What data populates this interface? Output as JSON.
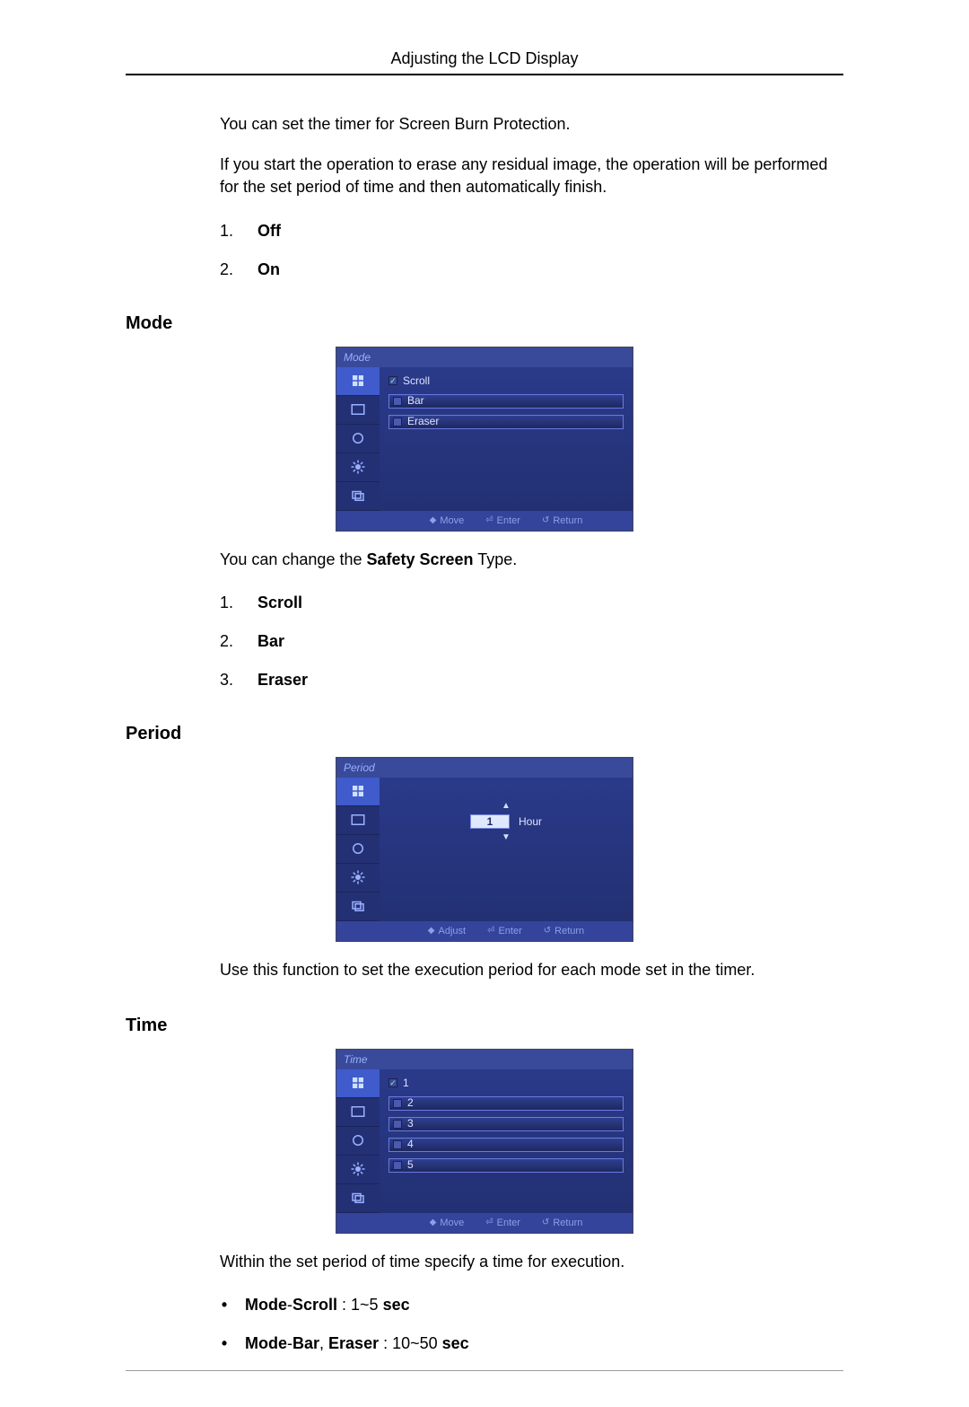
{
  "header": {
    "title": "Adjusting the LCD Display"
  },
  "intro": {
    "p1": "You can set the timer for Screen Burn Protection.",
    "p2": "If you start the operation to erase any residual image, the operation will be performed for the set period of time and then automatically finish."
  },
  "timer_options": {
    "items": [
      {
        "num": "1.",
        "label": "Off"
      },
      {
        "num": "2.",
        "label": "On"
      }
    ]
  },
  "mode_section": {
    "heading": "Mode",
    "caption_prefix": "You can change the ",
    "caption_bold": "Safety Screen",
    "caption_suffix": " Type.",
    "items": [
      {
        "num": "1.",
        "label": "Scroll"
      },
      {
        "num": "2.",
        "label": "Bar"
      },
      {
        "num": "3.",
        "label": "Eraser"
      }
    ],
    "osd": {
      "title": "Mode",
      "rows": [
        {
          "checked": true,
          "label": "Scroll"
        },
        {
          "checked": false,
          "label": "Bar"
        },
        {
          "checked": false,
          "label": "Eraser"
        }
      ],
      "hints": {
        "move": "Move",
        "enter": "Enter",
        "return": "Return"
      }
    }
  },
  "period_section": {
    "heading": "Period",
    "caption": "Use this function to set the execution period for each mode set in the timer.",
    "osd": {
      "title": "Period",
      "value": "1",
      "unit": "Hour",
      "hints": {
        "adjust": "Adjust",
        "enter": "Enter",
        "return": "Return"
      }
    }
  },
  "time_section": {
    "heading": "Time",
    "caption": "Within the set period of time specify a time for execution.",
    "bullets": [
      {
        "b1": "Mode",
        "t1": "-",
        "b2": "Scroll",
        "t2": " : 1~5 ",
        "b3": "sec"
      },
      {
        "b1": "Mode",
        "t1": "-",
        "b2": "Bar",
        "tcomma": ", ",
        "b2b": "Eraser",
        "t2": " : 10~50 ",
        "b3": "sec"
      }
    ],
    "osd": {
      "title": "Time",
      "rows": [
        {
          "checked": true,
          "label": "1"
        },
        {
          "checked": false,
          "label": "2"
        },
        {
          "checked": false,
          "label": "3"
        },
        {
          "checked": false,
          "label": "4"
        },
        {
          "checked": false,
          "label": "5"
        }
      ],
      "hints": {
        "move": "Move",
        "enter": "Enter",
        "return": "Return"
      }
    }
  },
  "icons": {
    "move": "◆",
    "enter": "⏎",
    "return": "↺",
    "adjust": "◆"
  }
}
